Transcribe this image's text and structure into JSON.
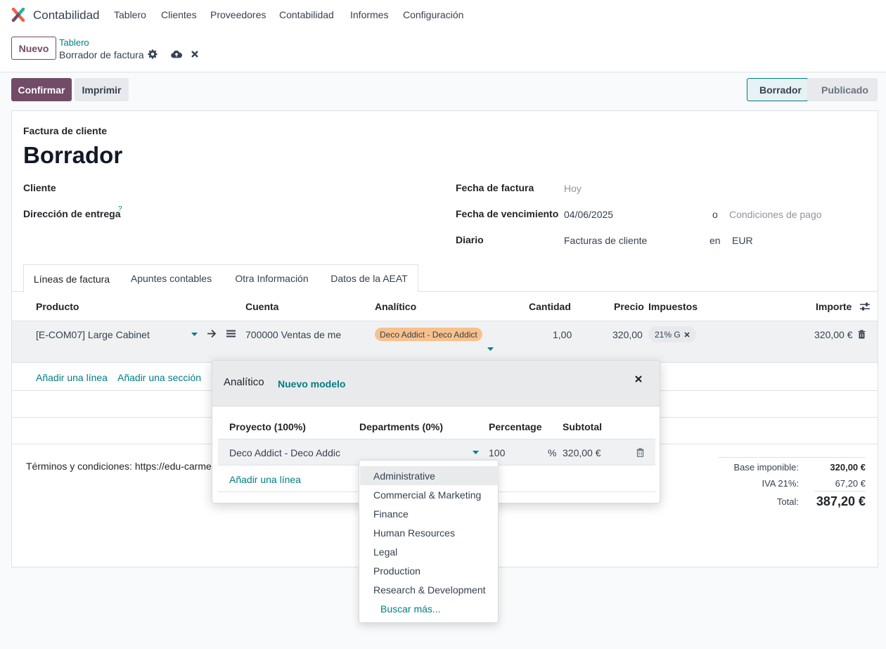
{
  "app": {
    "title": "Contabilidad",
    "accent": "#714b67",
    "link_color": "#017e84"
  },
  "menu": [
    "Tablero",
    "Clientes",
    "Proveedores",
    "Contabilidad",
    "Informes",
    "Configuración"
  ],
  "control": {
    "new_label": "Nuevo",
    "breadcrumb_parent": "Tablero",
    "breadcrumb_current": "Borrador de factura"
  },
  "actions": {
    "confirm": "Confirmar",
    "print": "Imprimir"
  },
  "status": {
    "draft": "Borrador",
    "published": "Publicado"
  },
  "form": {
    "doc_type": "Factura de cliente",
    "title": "Borrador",
    "customer_label": "Cliente",
    "delivery_label": "Dirección de entrega",
    "delivery_help": "?",
    "invoice_date_label": "Fecha de factura",
    "invoice_date_placeholder": "Hoy",
    "due_date_label": "Fecha de vencimiento",
    "due_date_value": "04/06/2025",
    "or_label": "o",
    "payment_terms_placeholder": "Condiciones de pago",
    "journal_label": "Diario",
    "journal_value": "Facturas de cliente",
    "currency_in": "en",
    "currency_value": "EUR"
  },
  "tabs": [
    "Líneas de factura",
    "Apuntes contables",
    "Otra Información",
    "Datos de la AEAT"
  ],
  "lines": {
    "headers": {
      "product": "Producto",
      "account": "Cuenta",
      "analytic": "Analítico",
      "quantity": "Cantidad",
      "price": "Precio",
      "taxes": "Impuestos",
      "amount": "Importe"
    },
    "row": {
      "product": "[E-COM07] Large Cabinet",
      "account": "700000 Ventas de me",
      "analytic": "Deco Addict - Deco Addict",
      "quantity": "1,00",
      "price": "320,00",
      "tax": "21% G",
      "amount": "320,00 €"
    },
    "add_line": "Añadir una línea",
    "add_section": "Añadir una sección"
  },
  "terms": "Términos y condiciones: https://edu-carme",
  "totals": {
    "base_label": "Base imponible:",
    "base_value": "320,00 €",
    "vat_label": "IVA 21%:",
    "vat_value": "67,20 €",
    "total_label": "Total:",
    "total_value": "387,20 €"
  },
  "popup": {
    "title": "Analítico",
    "new_model": "Nuevo modelo",
    "headers": {
      "project": "Proyecto (100%)",
      "departments": "Departments (0%)",
      "percentage": "Percentage",
      "subtotal": "Subtotal"
    },
    "row": {
      "project": "Deco Addict - Deco Addic",
      "percentage": "100",
      "percent_sign": "%",
      "subtotal": "320,00 €"
    },
    "add_line": "Añadir una línea"
  },
  "dropdown": {
    "options": [
      "Administrative",
      "Commercial & Marketing",
      "Finance",
      "Human Resources",
      "Legal",
      "Production",
      "Research & Development"
    ],
    "search_more": "Buscar más..."
  }
}
